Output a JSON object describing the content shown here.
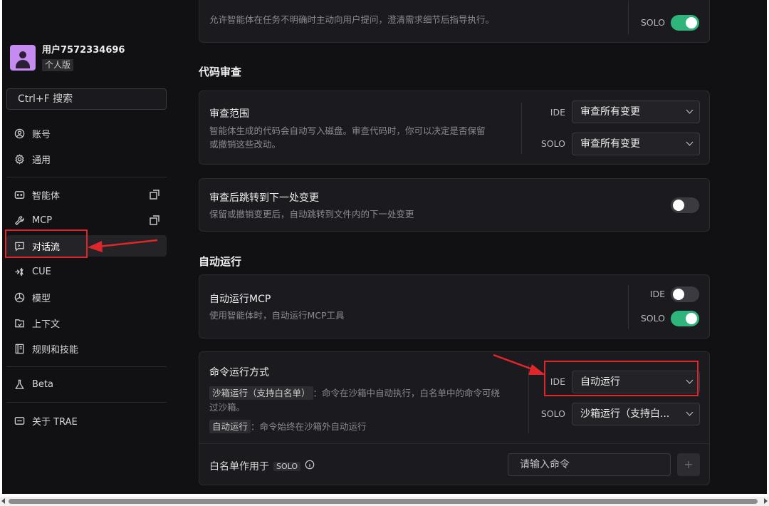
{
  "user": {
    "name": "用户7572334696",
    "plan": "个人版"
  },
  "search": {
    "placeholder": "Ctrl+F 搜索"
  },
  "sidebar": {
    "items": [
      {
        "label": "账号",
        "icon": "user-circle-icon"
      },
      {
        "label": "通用",
        "icon": "gear-icon"
      },
      {
        "label": "智能体",
        "icon": "agent-icon"
      },
      {
        "label": "MCP",
        "icon": "wrench-icon"
      },
      {
        "label": "对话流",
        "icon": "chat-icon"
      },
      {
        "label": "CUE",
        "icon": "cue-icon"
      },
      {
        "label": "模型",
        "icon": "model-icon"
      },
      {
        "label": "上下文",
        "icon": "context-icon"
      },
      {
        "label": "规则和技能",
        "icon": "rules-icon"
      },
      {
        "label": "Beta",
        "icon": "flask-icon"
      },
      {
        "label": "关于 TRAE",
        "icon": "info-icon"
      }
    ]
  },
  "top_card": {
    "desc": "允许智能体在任务不明确时主动向用户提问，澄清需求细节后指导执行。",
    "solo_label": "SOLO",
    "solo_on": true
  },
  "code_review": {
    "section_title": "代码审查",
    "scope": {
      "title": "审查范围",
      "desc_line1": "智能体生成的代码会自动写入磁盘。审查代码时，你可以决定是否保留",
      "desc_line2": "或撤销这些改动。",
      "ide_label": "IDE",
      "ide_value": "审查所有变更",
      "solo_label": "SOLO",
      "solo_value": "审查所有变更"
    },
    "jump": {
      "title": "审查后跳转到下一处变更",
      "desc": "保留或撤销变更后，自动跳转到文件内的下一处变更",
      "on": false
    }
  },
  "auto_run": {
    "section_title": "自动运行",
    "mcp": {
      "title": "自动运行MCP",
      "desc": "使用智能体时，自动运行MCP工具",
      "ide_label": "IDE",
      "ide_on": false,
      "solo_label": "SOLO",
      "solo_on": true
    },
    "command": {
      "title": "命令运行方式",
      "tag1": "沙箱运行（支持白名单）",
      "desc1_a": "：命令在沙箱中自动执行，白名单中的命令可绕",
      "desc1_b": "过沙箱。",
      "tag2": "自动运行",
      "desc2": "：命令始终在沙箱外自动运行",
      "ide_label": "IDE",
      "ide_value": "自动运行",
      "solo_label": "SOLO",
      "solo_value": "沙箱运行（支持白..."
    },
    "whitelist": {
      "label": "白名单作用于",
      "tag": "SOLO",
      "placeholder": "请输入命令",
      "add": "+"
    }
  },
  "colors": {
    "accent_green": "#2fb57c",
    "annotation_red": "#e0262b"
  }
}
